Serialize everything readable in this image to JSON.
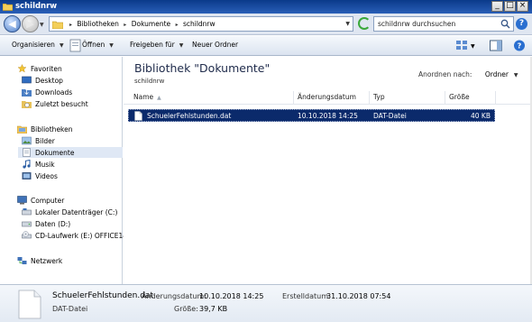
{
  "window": {
    "title": "schildnrw"
  },
  "address": {
    "crumbs": [
      "Bibliotheken",
      "Dokumente",
      "schildnrw"
    ],
    "search_placeholder": "schildnrw durchsuchen"
  },
  "toolbar": {
    "organize": "Organisieren",
    "open": "Öffnen",
    "share": "Freigeben für",
    "new_folder": "Neuer Ordner"
  },
  "nav": {
    "favorites": "Favoriten",
    "desktop": "Desktop",
    "downloads": "Downloads",
    "recent": "Zuletzt besucht",
    "libraries": "Bibliotheken",
    "pictures": "Bilder",
    "documents": "Dokumente",
    "music": "Musik",
    "videos": "Videos",
    "computer": "Computer",
    "drive_c": "Lokaler Datenträger (C:)",
    "drive_d": "Daten (D:)",
    "drive_e": "CD-Laufwerk (E:) OFFICE14",
    "network": "Netzwerk"
  },
  "content": {
    "title": "Bibliothek \"Dokumente\"",
    "subtitle": "schildnrw",
    "arrange_label": "Anordnen nach:",
    "arrange_value": "Ordner",
    "columns": {
      "name": "Name",
      "modified": "Änderungsdatum",
      "type": "Typ",
      "size": "Größe"
    },
    "files": [
      {
        "name": "SchuelerFehlstunden.dat",
        "modified": "10.10.2018 14:25",
        "type": "DAT-Datei",
        "size": "40 KB"
      }
    ]
  },
  "details": {
    "filename": "SchuelerFehlstunden.dat",
    "filetype": "DAT-Datei",
    "modified_label": "Änderungsdatum:",
    "modified_value": "10.10.2018 14:25",
    "size_label": "Größe:",
    "size_value": "39,7 KB",
    "created_label": "Erstelldatum:",
    "created_value": "31.10.2018 07:54"
  },
  "colors": {
    "selection": "#0b2a6b",
    "titlebar": "#0a3a8a"
  }
}
